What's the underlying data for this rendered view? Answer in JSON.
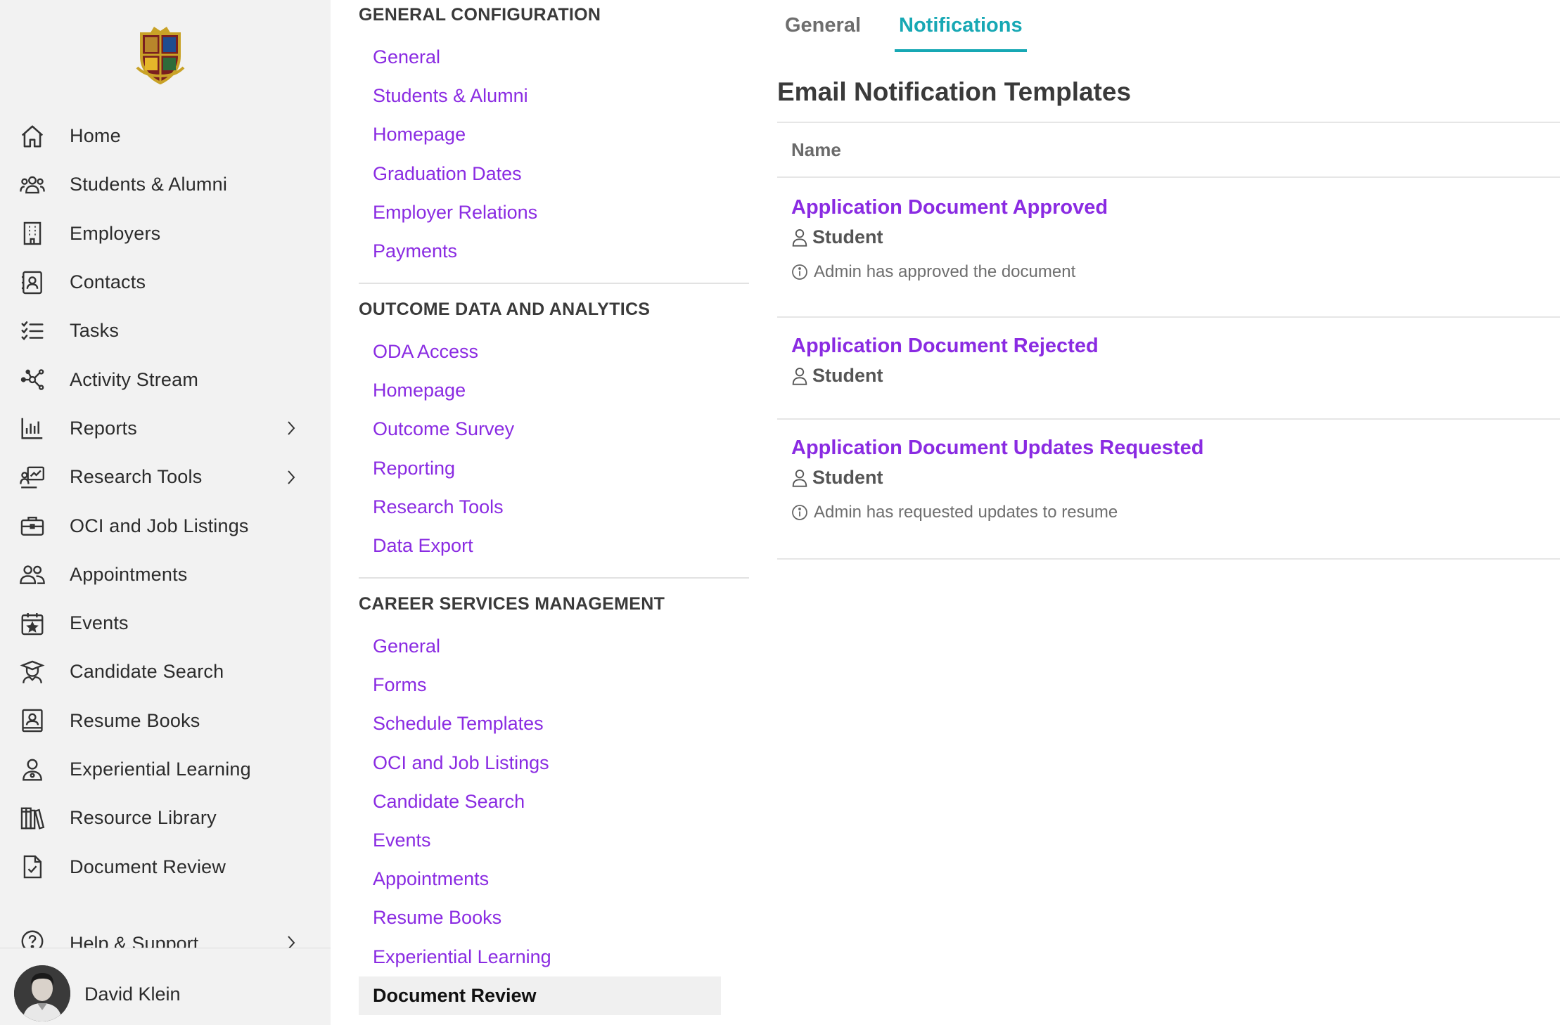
{
  "sidebar": {
    "logo_icon": "school-crest-icon",
    "items": [
      {
        "label": "Home",
        "icon": "home-icon",
        "has_chevron": false
      },
      {
        "label": "Students & Alumni",
        "icon": "people-group-icon",
        "has_chevron": false
      },
      {
        "label": "Employers",
        "icon": "building-icon",
        "has_chevron": false
      },
      {
        "label": "Contacts",
        "icon": "contact-card-icon",
        "has_chevron": false
      },
      {
        "label": "Tasks",
        "icon": "checklist-icon",
        "has_chevron": false
      },
      {
        "label": "Activity Stream",
        "icon": "network-icon",
        "has_chevron": false
      },
      {
        "label": "Reports",
        "icon": "bar-chart-icon",
        "has_chevron": true
      },
      {
        "label": "Research Tools",
        "icon": "research-chart-icon",
        "has_chevron": true
      },
      {
        "label": "OCI and Job Listings",
        "icon": "briefcase-icon",
        "has_chevron": false
      },
      {
        "label": "Appointments",
        "icon": "two-people-icon",
        "has_chevron": false
      },
      {
        "label": "Events",
        "icon": "calendar-star-icon",
        "has_chevron": false
      },
      {
        "label": "Candidate Search",
        "icon": "graduate-icon",
        "has_chevron": false
      },
      {
        "label": "Resume Books",
        "icon": "resume-book-icon",
        "has_chevron": false
      },
      {
        "label": "Experiential Learning",
        "icon": "person-badge-icon",
        "has_chevron": false
      },
      {
        "label": "Resource Library",
        "icon": "books-icon",
        "has_chevron": false
      },
      {
        "label": "Document Review",
        "icon": "document-check-icon",
        "has_chevron": false
      }
    ],
    "help": {
      "label": "Help & Support",
      "icon": "question-circle-icon"
    },
    "user": {
      "name": "David Klein"
    }
  },
  "settings": {
    "sections": [
      {
        "title": "GENERAL CONFIGURATION",
        "links": [
          "General",
          "Students & Alumni",
          "Homepage",
          "Graduation Dates",
          "Employer Relations",
          "Payments"
        ]
      },
      {
        "title": "OUTCOME DATA AND ANALYTICS",
        "links": [
          "ODA Access",
          "Homepage",
          "Outcome Survey",
          "Reporting",
          "Research Tools",
          "Data Export"
        ]
      },
      {
        "title": "CAREER SERVICES MANAGEMENT",
        "links": [
          "General",
          "Forms",
          "Schedule Templates",
          "OCI and Job Listings",
          "Candidate Search",
          "Events",
          "Appointments",
          "Resume Books",
          "Experiential Learning",
          "Document Review"
        ],
        "active_link": "Document Review"
      }
    ]
  },
  "main": {
    "tabs": [
      {
        "label": "General",
        "active": false
      },
      {
        "label": "Notifications",
        "active": true
      }
    ],
    "title": "Email Notification Templates",
    "table": {
      "header": "Name",
      "rows": [
        {
          "name": "Application Document Approved",
          "recipient": "Student",
          "description": "Admin has approved the document"
        },
        {
          "name": "Application Document Rejected",
          "recipient": "Student",
          "description": ""
        },
        {
          "name": "Application Document Updates Requested",
          "recipient": "Student",
          "description": "Admin has requested updates to resume"
        }
      ]
    }
  },
  "colors": {
    "link": "#8a2be2",
    "tab_active": "#17a8b4",
    "sidebar_bg": "#f2f2f2"
  }
}
